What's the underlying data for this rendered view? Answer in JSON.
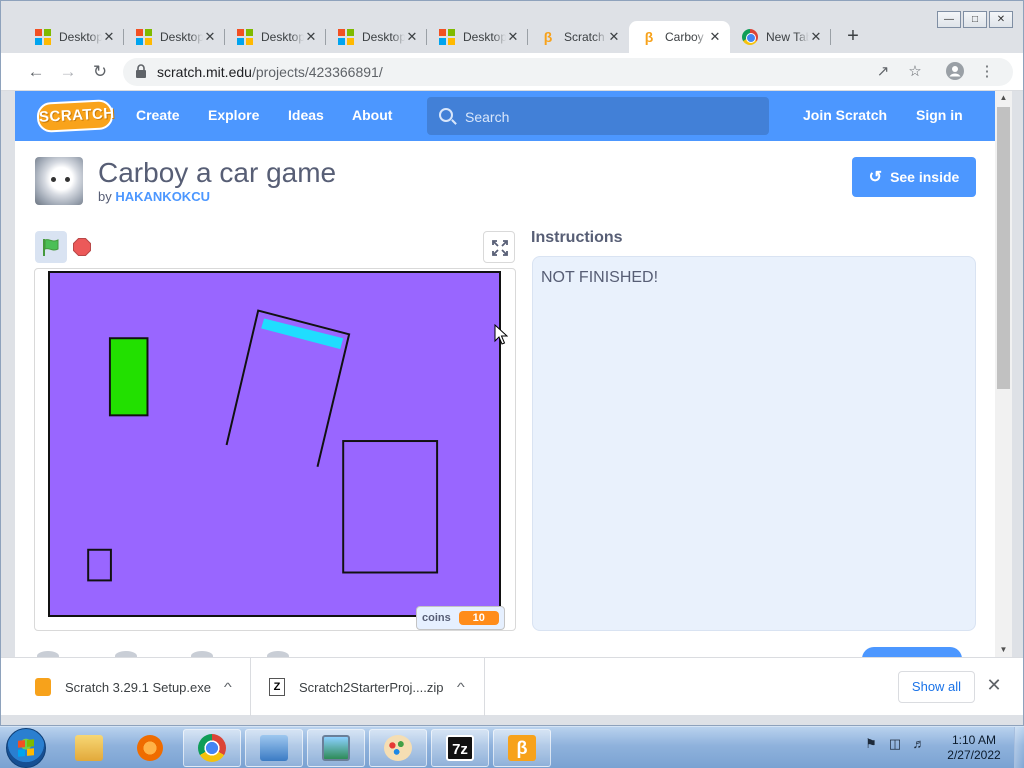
{
  "browser": {
    "tabs": [
      {
        "label": "Desktop",
        "favicon": "microsoft-icon"
      },
      {
        "label": "Desktop",
        "favicon": "microsoft-icon"
      },
      {
        "label": "Desktop",
        "favicon": "microsoft-icon"
      },
      {
        "label": "Desktop",
        "favicon": "microsoft-icon"
      },
      {
        "label": "Desktop",
        "favicon": "microsoft-icon"
      },
      {
        "label": "Scratch",
        "favicon": "scratch-icon"
      },
      {
        "label": "Carboy a car game",
        "favicon": "scratch-icon",
        "active": true
      },
      {
        "label": "New Tab",
        "favicon": "chrome-icon"
      }
    ],
    "url_host": "scratch.mit.edu",
    "url_path": "/projects/423366891/"
  },
  "nav": {
    "logo": "SCRATCH",
    "create": "Create",
    "explore": "Explore",
    "ideas": "Ideas",
    "about": "About",
    "search_placeholder": "Search",
    "join": "Join Scratch",
    "signin": "Sign in",
    "color": "#4c97ff"
  },
  "project": {
    "title": "Carboy a car game",
    "by_prefix": "by",
    "author": "HAKANKOKCU",
    "see_inside": "See inside",
    "instructions_heading": "Instructions",
    "instructions_text": "NOT FINISHED!",
    "stage_color": "#9966ff",
    "monitor": {
      "label": "coins",
      "value": "10"
    }
  },
  "downloads": {
    "items": [
      {
        "name": "Scratch 3.29.1 Setup.exe",
        "icon": "scratch-installer-icon"
      },
      {
        "name": "Scratch2StarterProj....zip",
        "icon": "zip-archive-icon"
      }
    ],
    "show_all": "Show all"
  },
  "taskbar": {
    "apps": [
      "file-explorer-icon",
      "media-player-icon",
      "chrome-icon",
      "control-panel-icon",
      "image-viewer-icon",
      "paint-icon",
      "7zip-icon",
      "scratch-app-icon"
    ],
    "time": "1:10 AM",
    "date": "2/27/2022"
  }
}
